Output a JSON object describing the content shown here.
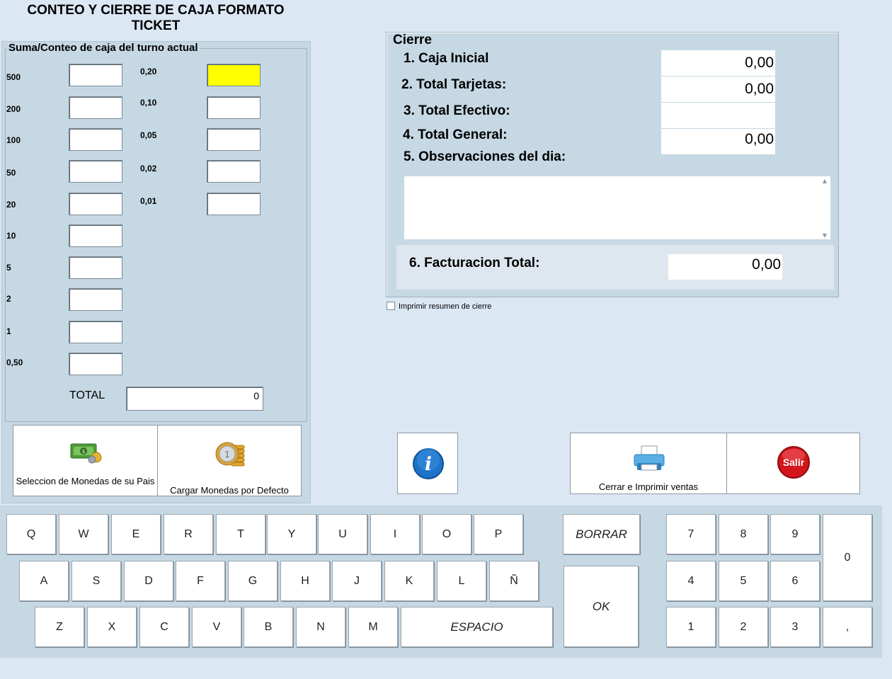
{
  "title": "CONTEO Y CIERRE DE CAJA FORMATO TICKET",
  "count": {
    "legend": "Suma/Conteo de caja del turno actual",
    "left_denoms": [
      "500",
      "200",
      "100",
      "50",
      "20",
      "10",
      "5",
      "2",
      "1",
      "0,50"
    ],
    "right_denoms": [
      "0,20",
      "0,10",
      "0,05",
      "0,02",
      "0,01"
    ],
    "total_label": "TOTAL",
    "total_value": "0",
    "highlight_color": "#ffff00"
  },
  "buttons": {
    "select_coins": "Seleccion de Monedas de su Pais",
    "load_coins": "Cargar Monedas por Defecto",
    "close_print": "Cerrar e Imprimir ventas",
    "exit": "Salir"
  },
  "cierre": {
    "legend": "Cierre",
    "caja_inicial_label": "1. Caja Inicial",
    "caja_inicial_value": "0,00",
    "tarjetas_label": "2. Total Tarjetas:",
    "tarjetas_value": "0,00",
    "efectivo_label": "3. Total Efectivo:",
    "efectivo_value": "",
    "general_label": "4. Total General:",
    "general_value": "0,00",
    "observaciones_label": "5. Observaciones del dia:",
    "observaciones_value": "",
    "facturacion_label": "6. Facturacion Total:",
    "facturacion_value": "0,00",
    "print_summary_label": "Imprimir resumen de cierre"
  },
  "keyboard": {
    "row1": [
      "Q",
      "W",
      "E",
      "R",
      "T",
      "Y",
      "U",
      "I",
      "O",
      "P"
    ],
    "row2": [
      "A",
      "S",
      "D",
      "F",
      "G",
      "H",
      "J",
      "K",
      "L",
      "Ñ"
    ],
    "row3": [
      "Z",
      "X",
      "C",
      "V",
      "B",
      "N",
      "M"
    ],
    "space": "ESPACIO",
    "delete": "BORRAR",
    "ok": "OK",
    "numpad": [
      "7",
      "8",
      "9",
      "4",
      "5",
      "6",
      "1",
      "2",
      "3"
    ],
    "zero": "0",
    "comma": ","
  },
  "colors": {
    "background": "#dce7f4",
    "panel": "#c6d8e3",
    "exit_red": "#d2161c",
    "info_blue": "#1d73c9"
  }
}
